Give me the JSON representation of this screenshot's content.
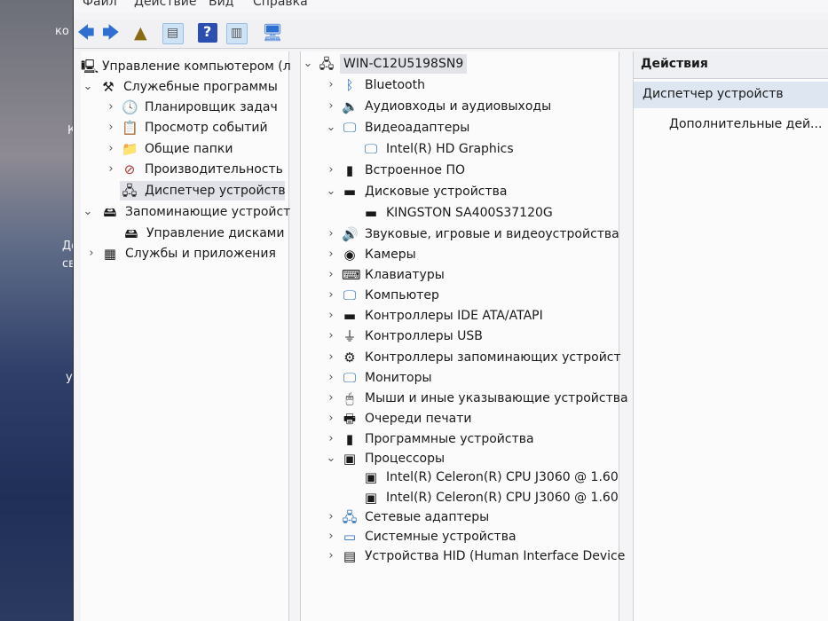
{
  "desktop": {
    "labels": [
      "ко",
      "К",
      "До",
      "св",
      "упр"
    ]
  },
  "menu": {
    "file": "Файл",
    "action": "Действие",
    "view": "Вид",
    "help": "Справка"
  },
  "left_tree": [
    {
      "label": "Управление компьютером (л",
      "icon": "computer-management-icon",
      "level": 0,
      "expander": ""
    },
    {
      "label": "Служебные программы",
      "icon": "tools-icon",
      "level": 1,
      "expander": "v"
    },
    {
      "label": "Планировщик задач",
      "icon": "clock-icon",
      "level": 2,
      "expander": ">"
    },
    {
      "label": "Просмотр событий",
      "icon": "event-viewer-icon",
      "level": 2,
      "expander": ">"
    },
    {
      "label": "Общие папки",
      "icon": "shared-folder-icon",
      "level": 2,
      "expander": ">"
    },
    {
      "label": "Производительность",
      "icon": "performance-icon",
      "level": 2,
      "expander": ">"
    },
    {
      "label": "Диспетчер устройств",
      "icon": "device-manager-icon",
      "level": 2,
      "expander": "",
      "selected": true
    },
    {
      "label": "Запоминающие устройст",
      "icon": "storage-icon",
      "level": 1,
      "expander": "v"
    },
    {
      "label": "Управление дисками",
      "icon": "disk-management-icon",
      "level": 2,
      "expander": ""
    },
    {
      "label": "Службы и приложения",
      "icon": "services-icon",
      "level": 1,
      "expander": ">"
    }
  ],
  "device_tree": [
    {
      "label": "WIN-C12U5198SN9",
      "icon": "computer-icon",
      "level": 0,
      "expander": "v",
      "selected": true
    },
    {
      "label": "Bluetooth",
      "icon": "bluetooth-icon",
      "level": 1,
      "expander": ">"
    },
    {
      "label": "Аудиовходы и аудиовыходы",
      "icon": "speaker-icon",
      "level": 1,
      "expander": ">"
    },
    {
      "label": "Видеоадаптеры",
      "icon": "monitor-icon",
      "level": 1,
      "expander": "v"
    },
    {
      "label": "Intel(R) HD Graphics",
      "icon": "display-adapter-icon",
      "level": 2,
      "expander": ""
    },
    {
      "label": "Встроенное ПО",
      "icon": "firmware-icon",
      "level": 1,
      "expander": ">"
    },
    {
      "label": "Дисковые устройства",
      "icon": "disk-icon",
      "level": 1,
      "expander": "v"
    },
    {
      "label": "KINGSTON SA400S37120G",
      "icon": "disk-drive-icon",
      "level": 2,
      "expander": ""
    },
    {
      "label": "Звуковые, игровые и видеоустройства",
      "icon": "sound-icon",
      "level": 1,
      "expander": ">"
    },
    {
      "label": "Камеры",
      "icon": "camera-icon",
      "level": 1,
      "expander": ">"
    },
    {
      "label": "Клавиатуры",
      "icon": "keyboard-icon",
      "level": 1,
      "expander": ">"
    },
    {
      "label": "Компьютер",
      "icon": "monitor-icon",
      "level": 1,
      "expander": ">"
    },
    {
      "label": "Контроллеры IDE ATA/ATAPI",
      "icon": "ide-controller-icon",
      "level": 1,
      "expander": ">"
    },
    {
      "label": "Контроллеры USB",
      "icon": "usb-icon",
      "level": 1,
      "expander": ">"
    },
    {
      "label": "Контроллеры запоминающих устройст",
      "icon": "storage-controller-icon",
      "level": 1,
      "expander": ">"
    },
    {
      "label": "Мониторы",
      "icon": "monitor-icon",
      "level": 1,
      "expander": ">"
    },
    {
      "label": "Мыши и иные указывающие устройства",
      "icon": "mouse-icon",
      "level": 1,
      "expander": ">"
    },
    {
      "label": "Очереди печати",
      "icon": "printer-icon",
      "level": 1,
      "expander": ">"
    },
    {
      "label": "Программные устройства",
      "icon": "software-device-icon",
      "level": 1,
      "expander": ">"
    },
    {
      "label": "Процессоры",
      "icon": "processor-icon",
      "level": 1,
      "expander": "v"
    },
    {
      "label": "Intel(R) Celeron(R) CPU  J3060  @ 1.60",
      "icon": "processor-icon",
      "level": 2,
      "expander": ""
    },
    {
      "label": "Intel(R) Celeron(R) CPU  J3060  @ 1.60",
      "icon": "processor-icon",
      "level": 2,
      "expander": ""
    },
    {
      "label": "Сетевые адаптеры",
      "icon": "network-adapter-icon",
      "level": 1,
      "expander": ">"
    },
    {
      "label": "Системные устройства",
      "icon": "system-device-icon",
      "level": 1,
      "expander": ">"
    },
    {
      "label": "Устройства HID (Human Interface Device",
      "icon": "hid-icon",
      "level": 1,
      "expander": ">"
    }
  ],
  "actions": {
    "header": "Действия",
    "primary": "Диспетчер устройств",
    "more": "Дополнительные дей..."
  }
}
